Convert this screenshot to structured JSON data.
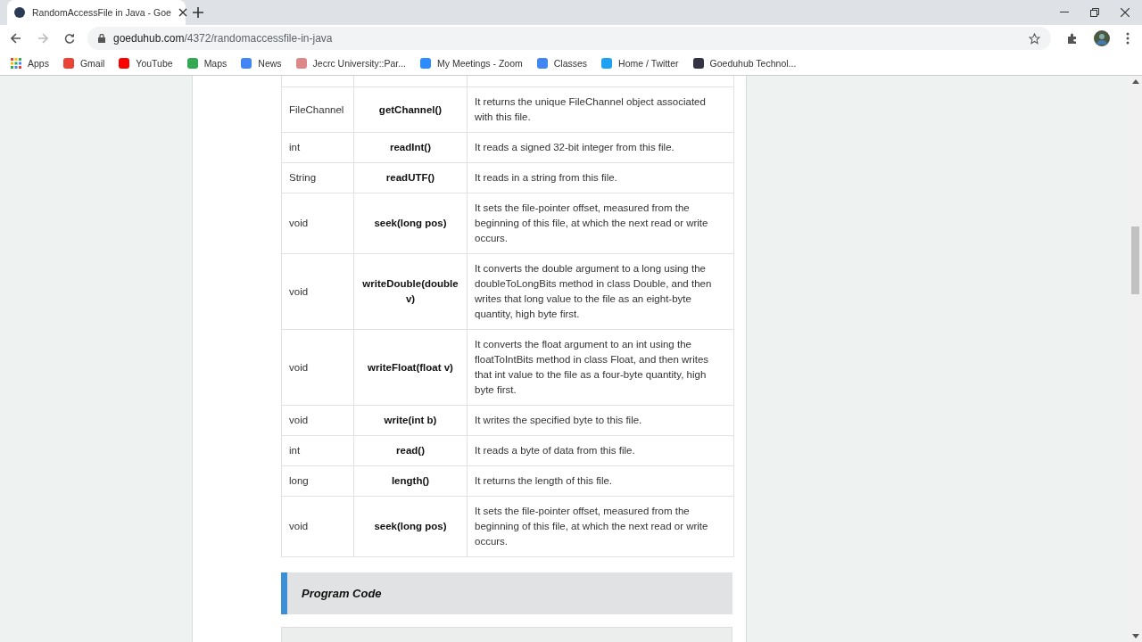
{
  "browser": {
    "tab": {
      "title": "RandomAccessFile in Java - Goe"
    },
    "address": {
      "domain": "goeduhub.com",
      "path": "/4372/randomaccessfile-in-java"
    },
    "bookmarks": [
      {
        "label": "Apps"
      },
      {
        "label": "Gmail"
      },
      {
        "label": "YouTube"
      },
      {
        "label": "Maps"
      },
      {
        "label": "News"
      },
      {
        "label": "Jecrc University::Par..."
      },
      {
        "label": "My Meetings - Zoom"
      },
      {
        "label": "Classes"
      },
      {
        "label": "Home / Twitter"
      },
      {
        "label": "Goeduhub Technol..."
      }
    ]
  },
  "table": {
    "rows": [
      {
        "type": "FileChannel",
        "method": "getChannel()",
        "description": "It returns the unique FileChannel object associated with this file."
      },
      {
        "type": "int",
        "method": "readInt()",
        "description": "It reads a signed 32-bit integer from this file."
      },
      {
        "type": "String",
        "method": "readUTF()",
        "description": "It reads in a string from this file."
      },
      {
        "type": "void",
        "method": "seek(long pos)",
        "description": "It sets the file-pointer offset, measured from the beginning of this file, at which the next read or write occurs."
      },
      {
        "type": "void",
        "method": "writeDouble(double v)",
        "description": "It converts the double argument to a long using the doubleToLongBits method in class Double, and then writes that long value to the file as an eight-byte quantity, high byte first."
      },
      {
        "type": "void",
        "method": "writeFloat(float v)",
        "description": "It converts the float argument to an int using the floatToIntBits method in class Float, and then writes that int value to the file as a four-byte quantity, high byte first."
      },
      {
        "type": "void",
        "method": "write(int b)",
        "description": "It writes the specified byte to this file."
      },
      {
        "type": "int",
        "method": "read()",
        "description": "It reads a byte of data from this file."
      },
      {
        "type": "long",
        "method": "length()",
        "description": "It returns the length of this file."
      },
      {
        "type": "void",
        "method": "seek(long pos)",
        "description": "It sets the file-pointer offset, measured from the beginning of this file, at which the next read or write occurs."
      }
    ]
  },
  "section": {
    "heading": "Program Code"
  }
}
